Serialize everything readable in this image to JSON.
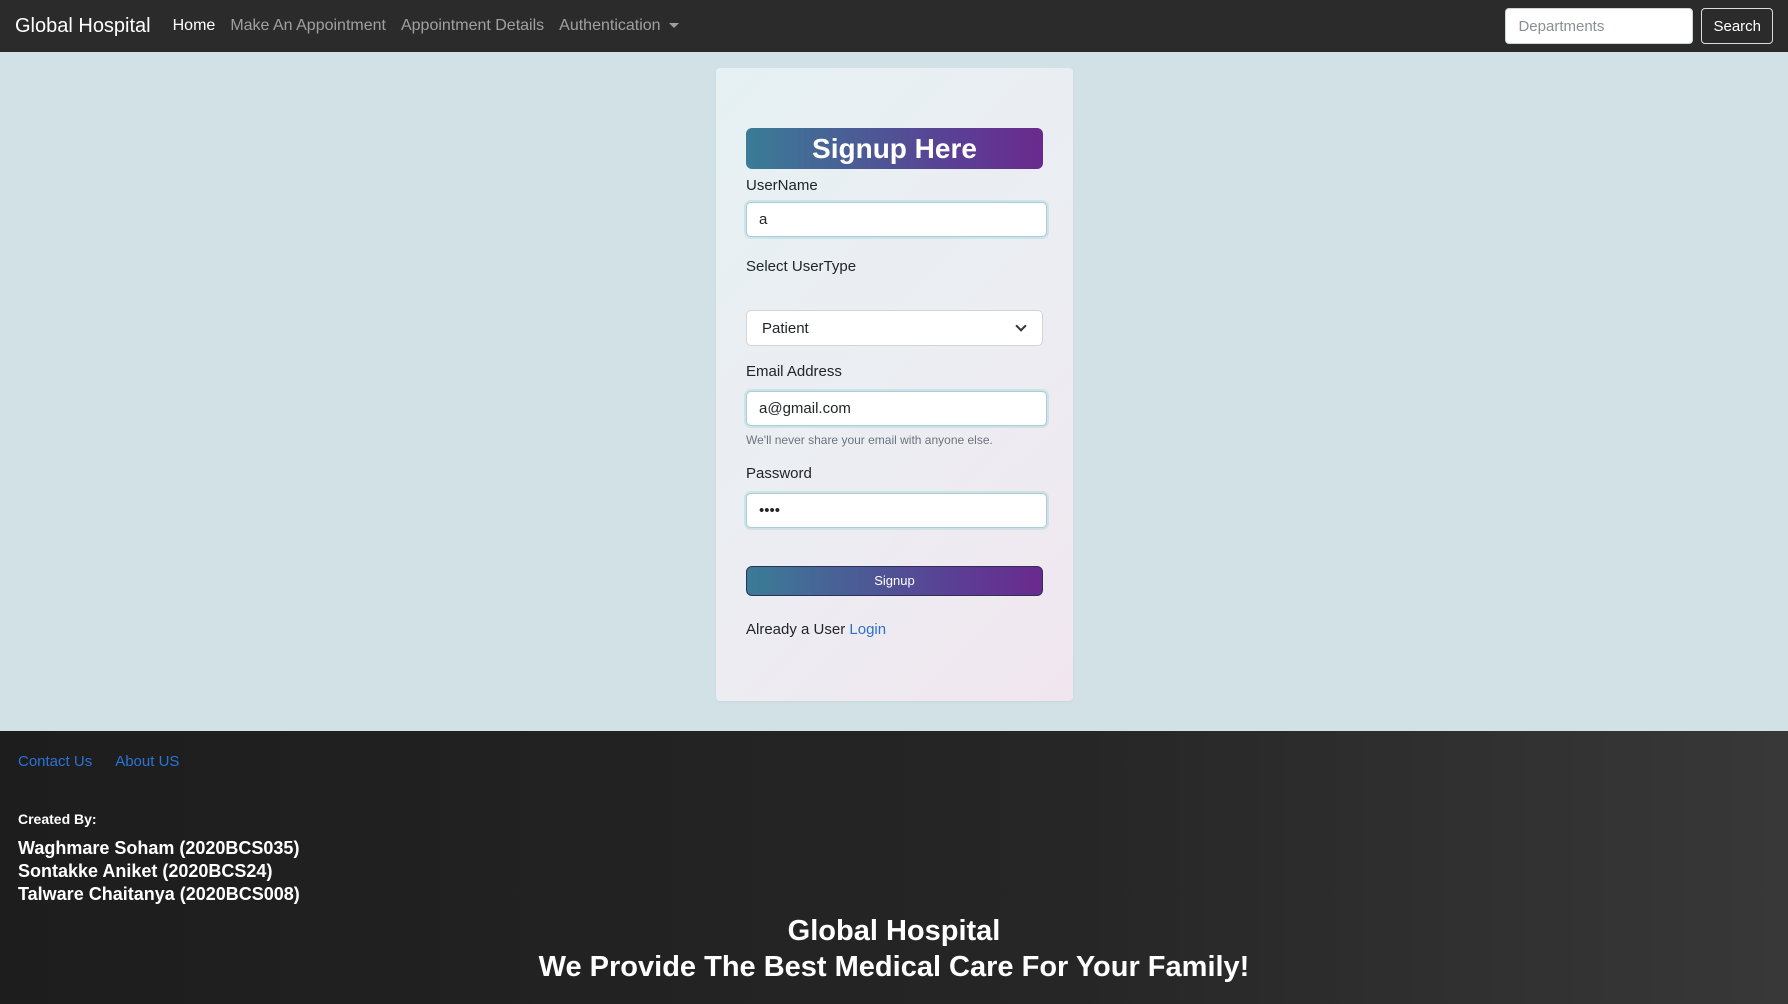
{
  "navbar": {
    "brand": "Global Hospital",
    "links": [
      {
        "label": "Home",
        "active": true
      },
      {
        "label": "Make An Appointment",
        "active": false
      },
      {
        "label": "Appointment Details",
        "active": false
      },
      {
        "label": "Authentication",
        "active": false,
        "dropdown": true
      }
    ],
    "search": {
      "placeholder": "Departments",
      "button_label": "Search"
    }
  },
  "form": {
    "title": "Signup Here",
    "username": {
      "label": "UserName",
      "value": "a"
    },
    "usertype": {
      "label": "Select UserType",
      "selected": "Patient"
    },
    "email": {
      "label": "Email Address",
      "value": "a@gmail.com",
      "help": "We'll never share your email with anyone else."
    },
    "password": {
      "label": "Password",
      "value": "aaaa"
    },
    "submit_label": "Signup",
    "already_text": "Already a User",
    "login_label": "Login"
  },
  "footer": {
    "links": [
      "Contact Us",
      "About US"
    ],
    "created_label": "Created By:",
    "creators": [
      "Waghmare Soham (2020BCS035)",
      "Sontakke Aniket (2020BCS24)",
      "Talware Chaitanya (2020BCS008)"
    ],
    "hospital_name": "Global Hospital",
    "tagline": "We Provide The Best Medical Care For Your Family!"
  },
  "colors": {
    "navbar_bg": "#2b2b2b",
    "page_bg": "#d1e1e6",
    "gradient_start": "#3a7c96",
    "gradient_end": "#6a2a8d",
    "link_blue": "#2a73c9"
  },
  "icons": [
    "chevron-down-icon",
    "caret-down-icon"
  ]
}
